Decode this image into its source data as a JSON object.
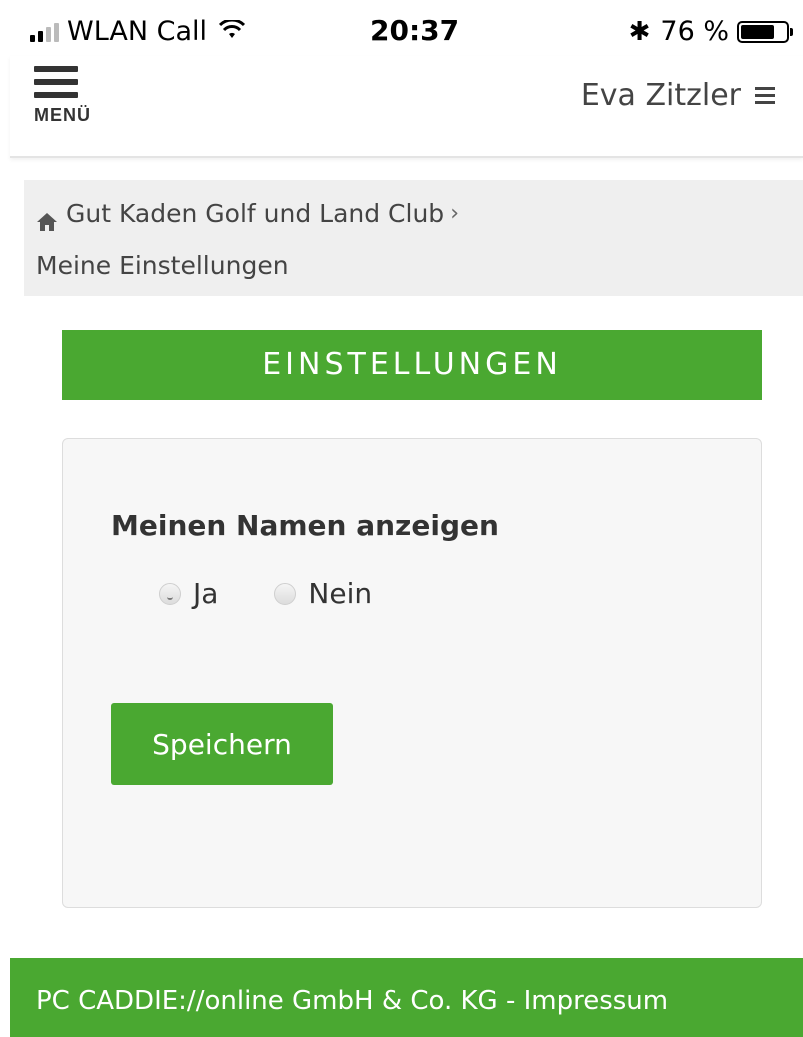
{
  "status_bar": {
    "carrier": "WLAN Call",
    "time": "20:37",
    "battery_percent": "76 %",
    "battery_level": 0.76
  },
  "header": {
    "menu_label": "MENÜ",
    "user_name": "Eva Zitzler"
  },
  "breadcrumb": {
    "home_label": "Gut Kaden Golf und Land Club",
    "separator": "›",
    "current": "Meine Einstellungen"
  },
  "section": {
    "title": "EINSTELLUNGEN"
  },
  "settings": {
    "field_label": "Meinen Namen anzeigen",
    "options": [
      {
        "label": "Ja",
        "selected": true
      },
      {
        "label": "Nein",
        "selected": false
      }
    ],
    "save_label": "Speichern"
  },
  "footer": {
    "text": "PC CADDIE://online GmbH & Co. KG - Impressum"
  },
  "colors": {
    "accent_green": "#4aa831",
    "breadcrumb_bg": "#efefef",
    "card_bg": "#f7f7f7"
  },
  "icons": {
    "home": "home-icon",
    "wifi": "wifi-icon",
    "bluetooth": "bluetooth-icon",
    "battery": "battery-icon",
    "menu": "hamburger-icon"
  }
}
